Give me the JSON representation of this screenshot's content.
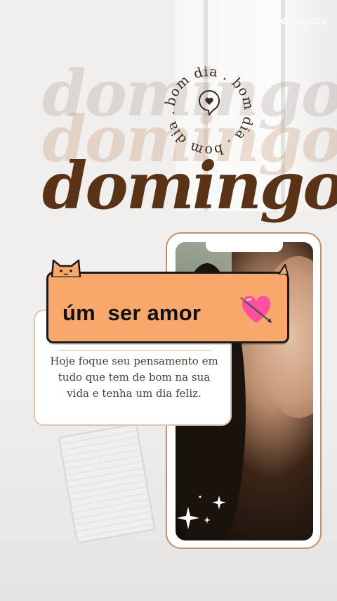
{
  "watermark": {
    "text": "CapCut",
    "icon": "capcut-logo-icon"
  },
  "headline": {
    "ghost_1": "domingo",
    "ghost_2": "domingo",
    "main": "domingo"
  },
  "badge": {
    "ring_text": "bom dia . bom dia . bom dia .",
    "icon": "heart-speech-bubble-icon"
  },
  "sticker": {
    "text": "úm  ser amor",
    "icon": "heart-with-arrow-emoji"
  },
  "quote": {
    "text": "Hoje foque seu pensamento em tudo que tem de bom na sua vida e tenha um dia feliz."
  },
  "colors": {
    "accent_orange": "#f9a86b",
    "brown": "#5a3317",
    "phone_border": "#c58f6a"
  }
}
